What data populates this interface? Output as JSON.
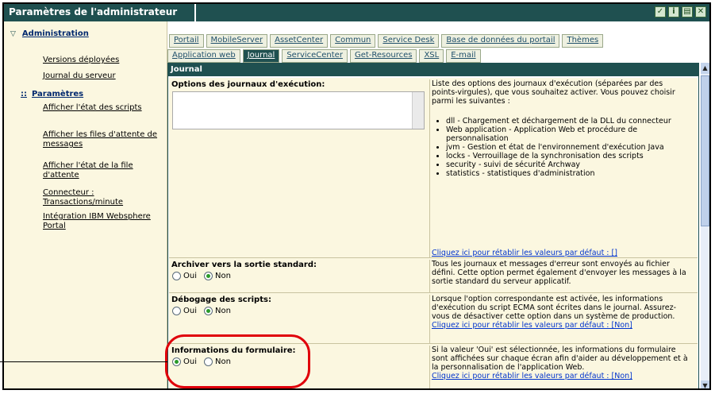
{
  "window": {
    "title": "Paramètres de l'administrateur",
    "icons": [
      "check-icon",
      "info-icon",
      "print-icon",
      "close-icon"
    ]
  },
  "sidebar": {
    "header": "Administration",
    "items_top": [
      "Versions déployées",
      "Journal du serveur"
    ],
    "section": "Paramètres",
    "items": [
      "Afficher l'état des scripts",
      "Afficher les files d'attente de messages",
      "Afficher l'état de la file d'attente",
      "Connecteur : Transactions/minute",
      "Intégration IBM Websphere Portal"
    ]
  },
  "tabs_row1": [
    "Portail",
    "MobileServer",
    "AssetCenter",
    "Commun",
    "Service Desk",
    "Base de données du portail",
    "Thèmes"
  ],
  "tabs_row2": [
    "Application web",
    "Journal",
    "ServiceCenter",
    "Get-Resources",
    "XSL",
    "E-mail"
  ],
  "active_tab": "Journal",
  "panel": {
    "title": "Journal",
    "logs": {
      "label": "Options des journaux d'exécution:",
      "desc": "Liste des options des journaux d'exécution (séparées par des points-virgules), que vous souhaitez activer. Vous pouvez choisir parmi les suivantes :",
      "options": [
        "dll - Chargement et déchargement de la DLL du connecteur",
        "Web application - Application Web et procédure de personnalisation",
        "jvm - Gestion et état de l'environnement d'exécution Java",
        "locks - Verrouillage de la synchronisation des scripts",
        "security - suivi de sécurité Archway",
        "statistics - statistiques d'administration"
      ],
      "reset": "Cliquez ici pour rétablir les valeurs par défaut : []"
    },
    "stdout": {
      "label": "Archiver vers la sortie standard:",
      "oui": "Oui",
      "non": "Non",
      "selected": "Non",
      "desc": "Tous les journaux et messages d'erreur sont envoyés au fichier défini. Cette option permet également d'envoyer les messages à la sortie standard du serveur applicatif."
    },
    "debug": {
      "label": "Débogage des scripts:",
      "oui": "Oui",
      "non": "Non",
      "selected": "Non",
      "desc": "Lorsque l'option correspondante est activée, les informations d'exécution du script ECMA sont écrites dans le journal. Assurez-vous de désactiver cette option dans un système de production.",
      "reset": "Cliquez ici pour rétablir les valeurs par défaut : [Non]"
    },
    "forminfo": {
      "label": "Informations du formulaire:",
      "oui": "Oui",
      "non": "Non",
      "selected": "Oui",
      "desc": "Si la valeur 'Oui' est sélectionnée, les informations du formulaire sont affichées sur chaque écran afin d'aider au développement et à la personnalisation de l'application Web.",
      "reset": "Cliquez ici pour rétablir les valeurs par défaut : [Non]"
    }
  },
  "colors": {
    "titlebar": "#1f5050",
    "sidebar_bg": "#fbf7e0",
    "callout": "#e0000a"
  }
}
